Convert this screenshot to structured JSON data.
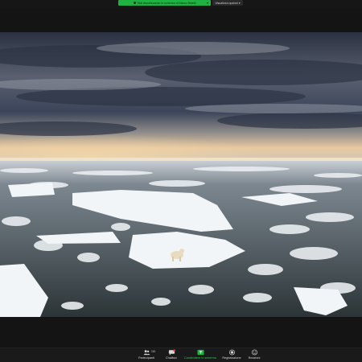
{
  "banner": {
    "share_text": "Stai visualizzando lo schermo di Marco Betelli",
    "view_options": "Visualizza opzioni",
    "colors": {
      "share_green": "#1fb141"
    }
  },
  "toolbar": {
    "participants": {
      "label": "Partecipanti",
      "count": "161",
      "icon": "participants-icon"
    },
    "chat": {
      "label": "Chatbox",
      "badge": "9",
      "icon": "chat-icon"
    },
    "share": {
      "label": "Condividere lo schermo",
      "icon": "share-screen-icon",
      "color": "#2ecc55"
    },
    "record": {
      "label": "Registrazione",
      "icon": "record-icon"
    },
    "reactions": {
      "label": "Reazioni",
      "icon": "reactions-icon"
    }
  }
}
